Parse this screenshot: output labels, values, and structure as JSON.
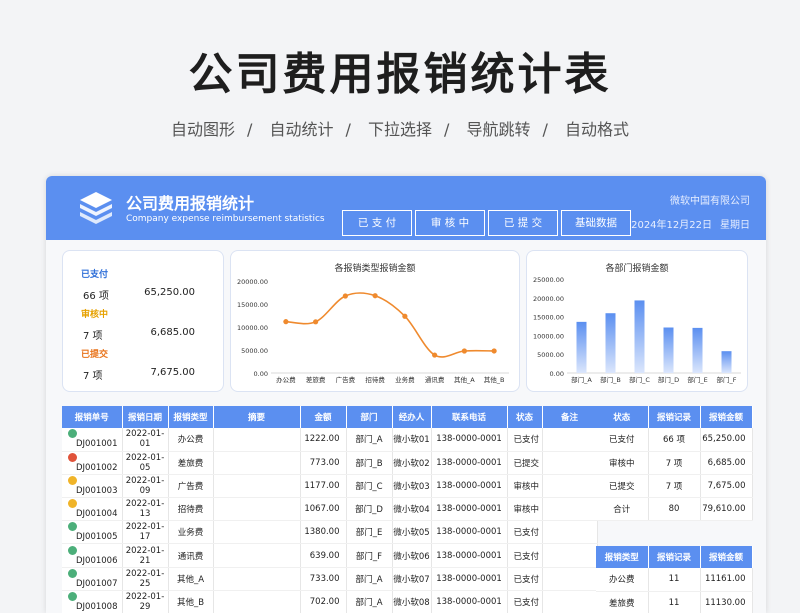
{
  "page": {
    "title": "公司费用报销统计表",
    "features": [
      "自动图形",
      "自动统计",
      "下拉选择",
      "导航跳转",
      "自动格式"
    ],
    "separator": "/"
  },
  "header": {
    "title": "公司费用报销统计",
    "subtitle_en": "Company expense reimbursement statistics",
    "company": "微软中国有限公司",
    "date": "2024年12月22日",
    "weekday": "星期日",
    "nav": [
      "已 支 付",
      "审 核 中",
      "已 提 交",
      "基础数据"
    ]
  },
  "summary": [
    {
      "label": "已支付",
      "count": "66 项",
      "amount": "65,250.00",
      "color": "#2f6fd8"
    },
    {
      "label": "审核中",
      "count": "7 项",
      "amount": "6,685.00",
      "color": "#e6a100"
    },
    {
      "label": "已提交",
      "count": "7 项",
      "amount": "7,675.00",
      "color": "#e8731a"
    }
  ],
  "chart_data": [
    {
      "type": "line",
      "title": "各报销类型报销金额",
      "categories": [
        "办公费",
        "差旅费",
        "广告费",
        "招待费",
        "业务费",
        "通讯费",
        "其他_A",
        "其他_B"
      ],
      "values": [
        11161,
        11130,
        16735,
        16800,
        12340,
        3900,
        4780,
        4790
      ],
      "y_ticks": [
        "0.00",
        "5000.00",
        "10000.00",
        "15000.00",
        "20000.00"
      ],
      "ylim": [
        0,
        20000
      ],
      "color": "#ef8a2e"
    },
    {
      "type": "bar",
      "title": "各部门报销金额",
      "categories": [
        "部门_A",
        "部门_B",
        "部门_C",
        "部门_D",
        "部门_E",
        "部门_F"
      ],
      "values": [
        13600,
        15900,
        19300,
        12100,
        12000,
        5800
      ],
      "y_ticks": [
        "0.00",
        "5000.00",
        "10000.00",
        "15000.00",
        "20000.00",
        "25000.00"
      ],
      "ylim": [
        0,
        25000
      ],
      "color": "#5b8ff0"
    }
  ],
  "main_table": {
    "headers": [
      "报销单号",
      "报销日期",
      "报销类型",
      "摘要",
      "金额",
      "部门",
      "经办人",
      "联系电话",
      "状态",
      "备注"
    ],
    "rows": [
      {
        "icon": "green",
        "id": "DJ001001",
        "date": "2022-01-01",
        "type": "办公费",
        "summary": "",
        "amount": "1222.00",
        "dept": "部门_A",
        "handler": "微小软01",
        "phone": "138-0000-0001",
        "status": "已支付",
        "note": ""
      },
      {
        "icon": "red",
        "id": "DJ001002",
        "date": "2022-01-05",
        "type": "差旅费",
        "summary": "",
        "amount": "773.00",
        "dept": "部门_B",
        "handler": "微小软02",
        "phone": "138-0000-0001",
        "status": "已提交",
        "note": ""
      },
      {
        "icon": "yellow",
        "id": "DJ001003",
        "date": "2022-01-09",
        "type": "广告费",
        "summary": "",
        "amount": "1177.00",
        "dept": "部门_C",
        "handler": "微小软03",
        "phone": "138-0000-0001",
        "status": "审核中",
        "note": ""
      },
      {
        "icon": "yellow",
        "id": "DJ001004",
        "date": "2022-01-13",
        "type": "招待费",
        "summary": "",
        "amount": "1067.00",
        "dept": "部门_D",
        "handler": "微小软04",
        "phone": "138-0000-0001",
        "status": "审核中",
        "note": ""
      },
      {
        "icon": "green",
        "id": "DJ001005",
        "date": "2022-01-17",
        "type": "业务费",
        "summary": "",
        "amount": "1380.00",
        "dept": "部门_E",
        "handler": "微小软05",
        "phone": "138-0000-0001",
        "status": "已支付",
        "note": ""
      },
      {
        "icon": "green",
        "id": "DJ001006",
        "date": "2022-01-21",
        "type": "通讯费",
        "summary": "",
        "amount": "639.00",
        "dept": "部门_F",
        "handler": "微小软06",
        "phone": "138-0000-0001",
        "status": "已支付",
        "note": ""
      },
      {
        "icon": "green",
        "id": "DJ001007",
        "date": "2022-01-25",
        "type": "其他_A",
        "summary": "",
        "amount": "733.00",
        "dept": "部门_A",
        "handler": "微小软07",
        "phone": "138-0000-0001",
        "status": "已支付",
        "note": ""
      },
      {
        "icon": "green",
        "id": "DJ001008",
        "date": "2022-01-29",
        "type": "其他_B",
        "summary": "",
        "amount": "702.00",
        "dept": "部门_A",
        "handler": "微小软08",
        "phone": "138-0000-0001",
        "status": "已支付",
        "note": ""
      }
    ]
  },
  "status_table": {
    "headers": [
      "状态",
      "报销记录",
      "报销金额"
    ],
    "rows": [
      {
        "status": "已支付",
        "count": "66 项",
        "amount": "65,250.00"
      },
      {
        "status": "审核中",
        "count": "7 项",
        "amount": "6,685.00"
      },
      {
        "status": "已提交",
        "count": "7 项",
        "amount": "7,675.00"
      },
      {
        "status": "合计",
        "count": "80",
        "amount": "79,610.00"
      }
    ]
  },
  "type_table": {
    "headers": [
      "报销类型",
      "报销记录",
      "报销金额"
    ],
    "rows": [
      {
        "type": "办公费",
        "count": "11",
        "amount": "11161.00"
      },
      {
        "type": "差旅费",
        "count": "11",
        "amount": "11130.00"
      }
    ]
  },
  "icon_colors": {
    "green": "#4caf7a",
    "red": "#e0533a",
    "yellow": "#f0b429"
  }
}
